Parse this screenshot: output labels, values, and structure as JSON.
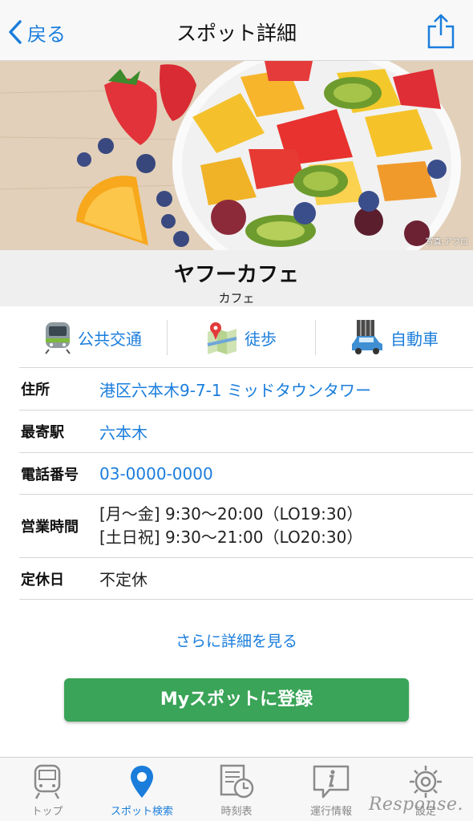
{
  "nav": {
    "back_label": "戻る",
    "title": "スポット詳細"
  },
  "hero": {
    "credit": "写真:アフロ"
  },
  "spot": {
    "name": "ヤフーカフェ",
    "category": "カフェ"
  },
  "modes": [
    {
      "label": "公共交通",
      "icon": "train-icon"
    },
    {
      "label": "徒歩",
      "icon": "walk-map-icon"
    },
    {
      "label": "自動車",
      "icon": "car-icon"
    }
  ],
  "details": {
    "address_label": "住所",
    "address": "港区六本木9-7-1 ミッドタウンタワー",
    "station_label": "最寄駅",
    "station": "六本木",
    "phone_label": "電話番号",
    "phone": "03-0000-0000",
    "hours_label": "営業時間",
    "hours_weekday": "[月〜金] 9:30〜20:00（LO19:30）",
    "hours_holiday": "[土日祝] 9:30〜21:00（LO20:30）",
    "closed_label": "定休日",
    "closed": "不定休"
  },
  "more_label": "さらに詳細を見る",
  "register_label": "Myスポットに登録",
  "tabs": [
    {
      "label": "トップ",
      "icon": "train-icon",
      "active": false
    },
    {
      "label": "スポット検索",
      "icon": "map-pin-icon",
      "active": true
    },
    {
      "label": "時刻表",
      "icon": "timetable-clock-icon",
      "active": false
    },
    {
      "label": "運行情報",
      "icon": "info-bubble-icon",
      "active": false
    },
    {
      "label": "設定",
      "icon": "gear-icon",
      "active": false
    }
  ],
  "watermark": "Response.",
  "colors": {
    "accent": "#1a7ddc",
    "register": "#3aa458"
  }
}
